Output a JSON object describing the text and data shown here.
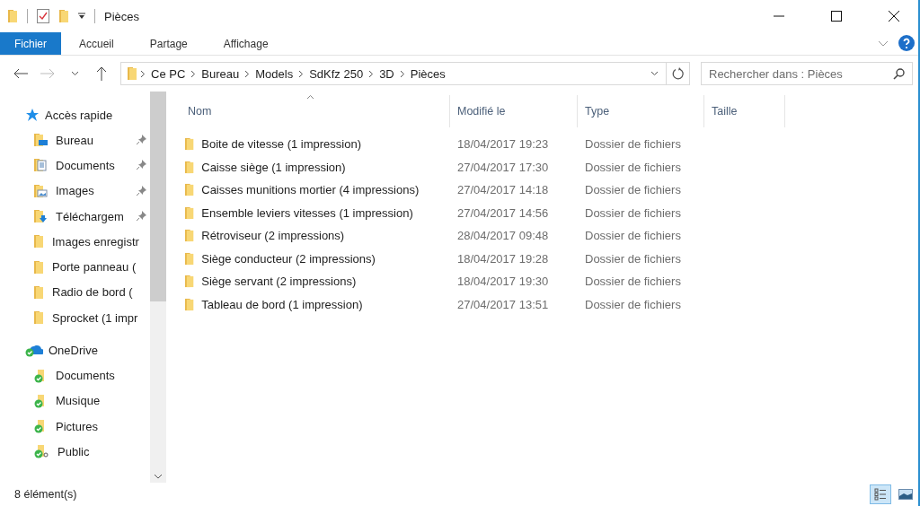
{
  "window": {
    "title": "Pièces"
  },
  "ribbon": {
    "tabs": [
      {
        "label": "Fichier",
        "selected": true
      },
      {
        "label": "Accueil",
        "selected": false
      },
      {
        "label": "Partage",
        "selected": false
      },
      {
        "label": "Affichage",
        "selected": false
      }
    ]
  },
  "address": {
    "crumbs": [
      "Ce PC",
      "Bureau",
      "Models",
      "SdKfz 250",
      "3D",
      "Pièces"
    ]
  },
  "search": {
    "placeholder": "Rechercher dans : Pièces"
  },
  "table": {
    "columns": [
      {
        "label": "Nom",
        "sorted": true
      },
      {
        "label": "Modifié le",
        "sorted": false
      },
      {
        "label": "Type",
        "sorted": false
      },
      {
        "label": "Taille",
        "sorted": false
      }
    ],
    "rows": [
      {
        "name": "Boite de vitesse (1 impression)",
        "modified": "18/04/2017 19:23",
        "type": "Dossier de fichiers"
      },
      {
        "name": "Caisse siège (1 impression)",
        "modified": "27/04/2017 17:30",
        "type": "Dossier de fichiers"
      },
      {
        "name": "Caisses munitions mortier (4 impressions)",
        "modified": "27/04/2017 14:18",
        "type": "Dossier de fichiers"
      },
      {
        "name": "Ensemble leviers vitesses (1 impression)",
        "modified": "27/04/2017 14:56",
        "type": "Dossier de fichiers"
      },
      {
        "name": "Rétroviseur (2 impressions)",
        "modified": "28/04/2017 09:48",
        "type": "Dossier de fichiers"
      },
      {
        "name": "Siège conducteur (2 impressions)",
        "modified": "18/04/2017 19:28",
        "type": "Dossier de fichiers"
      },
      {
        "name": "Siège servant (2 impressions)",
        "modified": "18/04/2017 19:30",
        "type": "Dossier de fichiers"
      },
      {
        "name": "Tableau de bord (1 impression)",
        "modified": "27/04/2017 13:51",
        "type": "Dossier de fichiers"
      }
    ]
  },
  "sidebar": {
    "groups": [
      {
        "label": "Accès rapide",
        "kind": "quick",
        "children": [
          {
            "label": "Bureau",
            "kind": "desktop",
            "pinned": true
          },
          {
            "label": "Documents",
            "kind": "documents",
            "pinned": true
          },
          {
            "label": "Images",
            "kind": "images",
            "pinned": true
          },
          {
            "label": "Téléchargem",
            "kind": "downloads",
            "pinned": true
          },
          {
            "label": "Images enregistr",
            "kind": "folder",
            "pinned": false
          },
          {
            "label": "Porte panneau (",
            "kind": "folder",
            "pinned": false
          },
          {
            "label": "Radio de bord (",
            "kind": "folder",
            "pinned": false
          },
          {
            "label": "Sprocket (1 impr",
            "kind": "folder",
            "pinned": false
          }
        ]
      },
      {
        "label": "OneDrive",
        "kind": "onedrive",
        "children": [
          {
            "label": "Documents",
            "kind": "synced",
            "pinned": false
          },
          {
            "label": "Musique",
            "kind": "synced",
            "pinned": false
          },
          {
            "label": "Pictures",
            "kind": "synced",
            "pinned": false
          },
          {
            "label": "Public",
            "kind": "shared",
            "pinned": false
          }
        ]
      }
    ]
  },
  "status_bar": {
    "count": "8 élément(s)",
    "views": [
      {
        "kind": "details",
        "selected": true
      },
      {
        "kind": "tiles",
        "selected": false
      }
    ]
  }
}
